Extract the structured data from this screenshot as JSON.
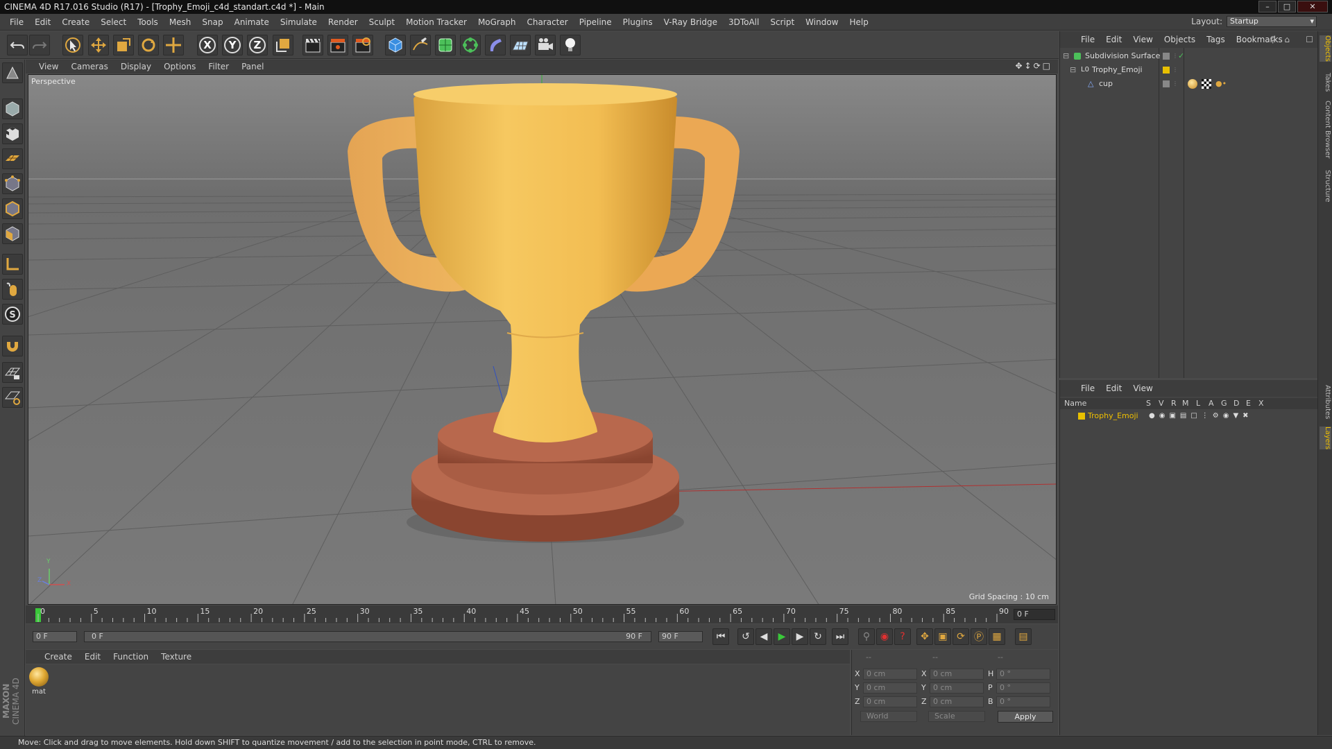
{
  "window": {
    "title": "CINEMA 4D R17.016 Studio (R17) - [Trophy_Emoji_c4d_standart.c4d *] - Main",
    "minimize": "–",
    "maximize": "□",
    "close": "✕"
  },
  "menubar": {
    "items": [
      "File",
      "Edit",
      "Create",
      "Select",
      "Tools",
      "Mesh",
      "Snap",
      "Animate",
      "Simulate",
      "Render",
      "Sculpt",
      "Motion Tracker",
      "MoGraph",
      "Character",
      "Pipeline",
      "Plugins",
      "V-Ray Bridge",
      "3DToAll",
      "Script",
      "Window",
      "Help"
    ],
    "layout_label": "Layout:",
    "layout_value": "Startup"
  },
  "toolbar": {
    "axis_x": "X",
    "axis_y": "Y",
    "axis_z": "Z"
  },
  "viewport": {
    "menu": [
      "View",
      "Cameras",
      "Display",
      "Options",
      "Filter",
      "Panel"
    ],
    "camera_label": "Perspective",
    "grid_spacing": "Grid Spacing : 10 cm",
    "axis_y": "Y",
    "axis_x": "X",
    "axis_z": "Z"
  },
  "timeline": {
    "ticks": [
      "0",
      "5",
      "10",
      "15",
      "20",
      "25",
      "30",
      "35",
      "40",
      "45",
      "50",
      "55",
      "60",
      "65",
      "70",
      "75",
      "80",
      "85",
      "90"
    ],
    "current_frame": "0 F",
    "start_field": "0 F",
    "range_start": "0 F",
    "range_end": "90 F",
    "end_field": "90 F"
  },
  "material_manager": {
    "menu": [
      "Create",
      "Edit",
      "Function",
      "Texture"
    ],
    "material_name": "mat"
  },
  "coordinates": {
    "header_a": "--",
    "header_b": "--",
    "header_c": "--",
    "rows": [
      {
        "l1": "X",
        "v1": "0 cm",
        "l2": "X",
        "v2": "0 cm",
        "l3": "H",
        "v3": "0 °"
      },
      {
        "l1": "Y",
        "v1": "0 cm",
        "l2": "Y",
        "v2": "0 cm",
        "l3": "P",
        "v3": "0 °"
      },
      {
        "l1": "Z",
        "v1": "0 cm",
        "l2": "Z",
        "v2": "0 cm",
        "l3": "B",
        "v3": "0 °"
      }
    ],
    "world": "World",
    "scale": "Scale",
    "apply": "Apply"
  },
  "object_manager": {
    "menu": [
      "File",
      "Edit",
      "View",
      "Objects",
      "Tags",
      "Bookmarks"
    ],
    "objects": [
      {
        "name": "Subdivision Surface"
      },
      {
        "name": "Trophy_Emoji"
      },
      {
        "name": "cup"
      }
    ]
  },
  "layer_manager": {
    "menu": [
      "File",
      "Edit",
      "View"
    ],
    "col_name": "Name",
    "flags": [
      "S",
      "V",
      "R",
      "M",
      "L",
      "A",
      "G",
      "D",
      "E",
      "X"
    ],
    "layer_name": "Trophy_Emoji",
    "layer_color": "#e8c000"
  },
  "side_tabs": [
    "Objects",
    "Takes",
    "Content Browser",
    "Structure",
    "Attributes",
    "Layers"
  ],
  "status": "Move: Click and drag to move elements. Hold down SHIFT to quantize movement / add to the selection in point mode, CTRL to remove.",
  "brand": {
    "line1": "MAXON",
    "line2": "CINEMA 4D"
  },
  "colors": {
    "accent": "#e0a840",
    "trophy_gold": "#f5c35a",
    "trophy_base": "#b8664a"
  }
}
